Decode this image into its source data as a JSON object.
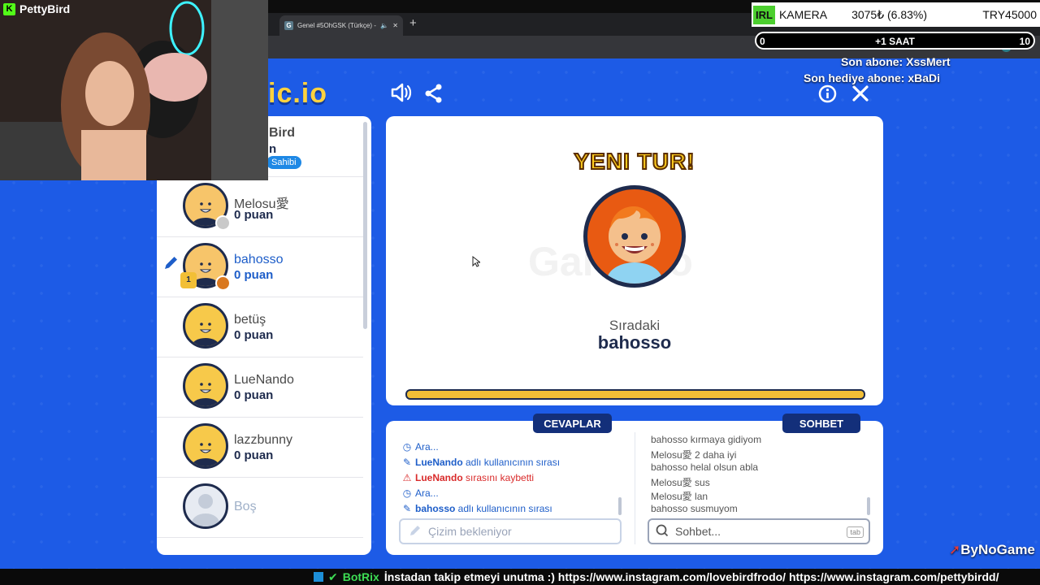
{
  "browser": {
    "tab_title": "Genel #5OhGSK (Türkçe) - ",
    "tab_favicon": "G",
    "new_tab_label": "+"
  },
  "game": {
    "logo_text": "ic.io",
    "sound_icon": "speaker-icon",
    "share_icon": "share-icon",
    "info_icon": "info-icon",
    "close_icon": "close-icon",
    "partial_player": {
      "name_partial": "Bird",
      "line2_partial": "n",
      "badge_partial": "Sahibi"
    },
    "players": [
      {
        "name": "Melosu愛",
        "score": "0 puan",
        "status_color": "#c9c9c9",
        "avatar_skin": "#f7c56a",
        "active": false
      },
      {
        "name": "bahosso",
        "score": "0 puan",
        "status_color": "#d9781f",
        "avatar_skin": "#f7c56a",
        "active": true,
        "rank": "1"
      },
      {
        "name": "betüş",
        "score": "0 puan",
        "status_color": "",
        "avatar_skin": "#f7c94a",
        "active": false
      },
      {
        "name": "LueNando",
        "score": "0 puan",
        "status_color": "",
        "avatar_skin": "#f7c94a",
        "active": false
      },
      {
        "name": "lazzbunny",
        "score": "0 puan",
        "status_color": "",
        "avatar_skin": "#f7c94a",
        "active": false
      },
      {
        "name": "Boş",
        "score": "",
        "status_color": "",
        "avatar_skin": "#e7ebf2",
        "active": false,
        "empty": true
      }
    ],
    "round": {
      "title": "YENI TUR!",
      "next_label": "Sıradaki",
      "next_player": "bahosso",
      "timer_fraction": 1.0
    },
    "answers": {
      "tab_label": "CEVAPLAR",
      "lines": [
        {
          "icon": "clock-icon",
          "prefix": "",
          "text": "Ara...",
          "color": "#1e5ec9"
        },
        {
          "icon": "pencil-icon",
          "prefix": "LueNando",
          "text": " adlı kullanıcının sırası",
          "color": "#1e5ec9"
        },
        {
          "icon": "warning-icon",
          "prefix": "LueNando",
          "text": " sırasını kaybetti",
          "color": "#d92b2b"
        },
        {
          "icon": "clock-icon",
          "prefix": "",
          "text": "Ara...",
          "color": "#1e5ec9"
        },
        {
          "icon": "pencil-icon",
          "prefix": "bahosso",
          "text": " adlı kullanıcının sırası",
          "color": "#1e5ec9"
        }
      ],
      "input_placeholder": "Çizim bekleniyor"
    },
    "chat": {
      "tab_label": "SOHBET",
      "lines": [
        {
          "user": "bahosso",
          "text": " kırmaya gidiyom"
        },
        {
          "user": "Melosu愛",
          "text": " 2 daha iyi"
        },
        {
          "user": "bahosso",
          "text": " helal olsun abla"
        },
        {
          "user": "Melosu愛",
          "text": " sus"
        },
        {
          "user": "Melosu愛",
          "text": " lan"
        },
        {
          "user": "bahosso",
          "text": " susmuyom"
        }
      ],
      "input_placeholder": "Sohbet...",
      "tab_key": "tab"
    }
  },
  "overlay": {
    "streamer": "PettyBird",
    "ticker_badge": "IRL",
    "ticker_name": "KAMERA",
    "ticker_value": "3075₺ (6.83%)",
    "ticker_goal": "TRY45000",
    "goal_left": "0",
    "goal_center": "+1 SAAT",
    "goal_right": "10",
    "last_sub": "Son abone: XssMert",
    "last_gift": "Son hediye abone: xBaDi",
    "brand": "ByNoGame",
    "bot_name": "BotRix",
    "bot_message": "İnstadan takip etmeyi unutma :) https://www.instagram.com/lovebirdfrodo/ https://www.instagram.com/pettybirdd/"
  }
}
